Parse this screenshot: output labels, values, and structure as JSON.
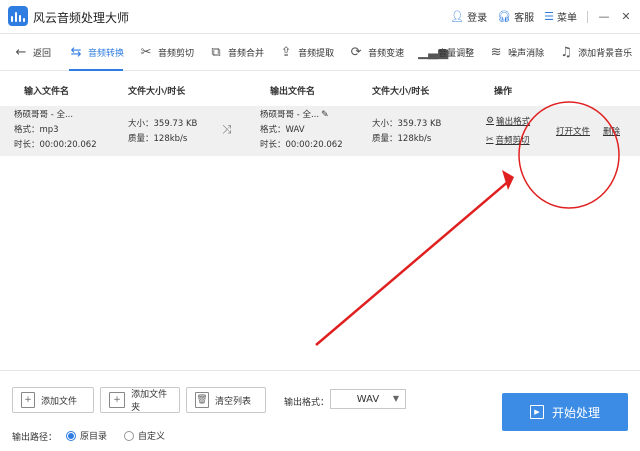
{
  "app": {
    "title": "风云音频处理大师",
    "login": "登录",
    "help": "客服",
    "menu": "菜单",
    "minimize": "—",
    "close": "✕"
  },
  "toolbar": {
    "back": "返回",
    "items": [
      {
        "label": "音频转换",
        "icon": "convert-icon"
      },
      {
        "label": "音频剪切",
        "icon": "scissors-icon"
      },
      {
        "label": "音频合并",
        "icon": "merge-icon"
      },
      {
        "label": "音频提取",
        "icon": "extract-icon"
      },
      {
        "label": "音频变速",
        "icon": "speed-icon"
      },
      {
        "label": "音量调整",
        "icon": "volume-icon"
      },
      {
        "label": "噪声消除",
        "icon": "noise-icon"
      },
      {
        "label": "添加背景音乐",
        "icon": "music-icon"
      }
    ]
  },
  "table": {
    "headers": {
      "input_name": "输入文件名",
      "input_size": "文件大小/时长",
      "output_name": "输出文件名",
      "output_size": "文件大小/时长",
      "ops": "操作"
    },
    "row": {
      "input_name": "杨硕哥哥 - 全...",
      "input_format": "格式：mp3",
      "input_duration": "时长：00:00:20.062",
      "input_size": "大小：359.73 KB",
      "input_quality": "质量：128kb/s",
      "output_name": "杨硕哥哥 - 全...",
      "output_format": "格式：WAV",
      "output_duration": "时长：00:00:20.062",
      "output_size": "大小：359.73 KB",
      "output_quality": "质量：128kb/s",
      "op_output_format": "输出格式",
      "op_cut": "音频剪切",
      "op_open": "打开文件",
      "op_delete": "删除"
    }
  },
  "bottom": {
    "add_file": "添加文件",
    "add_folder": "添加文件夹",
    "clear_list": "清空列表",
    "format_label": "输出格式：",
    "format_value": "WAV",
    "start": "开始处理",
    "path_label": "输出路径：",
    "path_options": [
      "原目录",
      "自定义"
    ],
    "path_selected": 0
  },
  "colors": {
    "accent": "#2f7de1",
    "start_button": "#3c8ce6",
    "annotation": "#e02020"
  }
}
